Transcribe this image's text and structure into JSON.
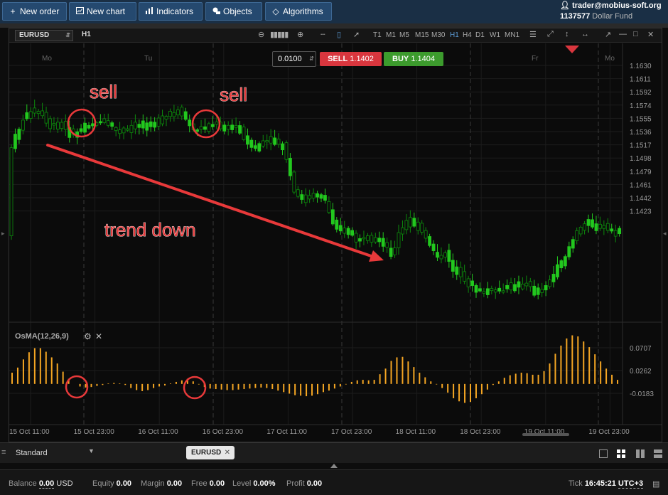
{
  "toolbar": {
    "new_order": "New order",
    "new_chart": "New chart",
    "indicators": "Indicators",
    "objects": "Objects",
    "algorithms": "Algorithms"
  },
  "account": {
    "user": "trader@mobius-soft.org",
    "account_number": "1137577",
    "fund_name": "Dollar Fund"
  },
  "chart": {
    "symbol": "EURUSD",
    "timeframe": "H1",
    "timeframes": [
      "T1",
      "M1",
      "M5",
      "M15",
      "M30",
      "H1",
      "H4",
      "D1",
      "W1",
      "MN1"
    ],
    "active_timeframe": "H1",
    "volume": "0.0100",
    "sell_label": "SELL",
    "sell_price": "1.1402",
    "buy_label": "BUY",
    "buy_price": "1.1404",
    "day_labels": [
      "Mo",
      "Tu",
      "Fr",
      "Mo"
    ],
    "price_ticks": [
      "1.1630",
      "1.1611",
      "1.1592",
      "1.1574",
      "1.1555",
      "1.1536",
      "1.1517",
      "1.1498",
      "1.1479",
      "1.1461",
      "1.1442",
      "1.1423"
    ],
    "time_ticks": [
      "15 Oct 11:00",
      "15 Oct 23:00",
      "16 Oct 11:00",
      "16 Oct 23:00",
      "17 Oct 11:00",
      "17 Oct 23:00",
      "18 Oct 11:00",
      "18 Oct 23:00",
      "19 Oct 11:00",
      "19 Oct 23:00"
    ],
    "annotations": {
      "sell_1": "sell",
      "sell_2": "sell",
      "trend": "trend down"
    },
    "colors": {
      "bull": "#22c81e",
      "bear": "#0c8a0c",
      "osma": "#f5a623",
      "annotation": "#e8393a",
      "sell_btn": "#d9363e",
      "buy_btn": "#3c9b2d"
    }
  },
  "indicator": {
    "name": "OsMA(12,26,9)",
    "ticks": [
      "0.0707",
      "0.0262",
      "-0.0183"
    ]
  },
  "chart_data": {
    "type": "bar",
    "title": "OsMA(12,26,9)",
    "ylim": [
      -0.0183,
      0.0707
    ],
    "values": [
      0.022,
      0.032,
      0.048,
      0.062,
      0.07,
      0.07,
      0.063,
      0.052,
      0.04,
      0.024,
      0.01,
      0.0,
      -0.005,
      -0.007,
      -0.006,
      -0.004,
      -0.002,
      0.001,
      0.002,
      0.001,
      -0.002,
      -0.008,
      -0.012,
      -0.014,
      -0.012,
      -0.008,
      -0.005,
      -0.003,
      0.001,
      0.004,
      0.007,
      0.01,
      0.005,
      -0.001,
      -0.006,
      -0.009,
      -0.01,
      -0.011,
      -0.012,
      -0.012,
      -0.011,
      -0.01,
      -0.009,
      -0.008,
      -0.007,
      -0.008,
      -0.01,
      -0.013,
      -0.016,
      -0.019,
      -0.022,
      -0.023,
      -0.024,
      -0.023,
      -0.02,
      -0.016,
      -0.013,
      -0.009,
      -0.005,
      -0.001,
      0.004,
      0.007,
      0.008,
      0.007,
      0.008,
      0.019,
      0.03,
      0.045,
      0.052,
      0.053,
      0.044,
      0.033,
      0.022,
      0.013,
      0.005,
      -0.001,
      -0.008,
      -0.017,
      -0.028,
      -0.034,
      -0.037,
      -0.035,
      -0.028,
      -0.02,
      -0.011,
      -0.002,
      0.005,
      0.012,
      0.017,
      0.02,
      0.022,
      0.021,
      0.018,
      0.018,
      0.025,
      0.04,
      0.059,
      0.075,
      0.089,
      0.095,
      0.093,
      0.083,
      0.072,
      0.058,
      0.044,
      0.03,
      0.018,
      0.008
    ]
  }
}
